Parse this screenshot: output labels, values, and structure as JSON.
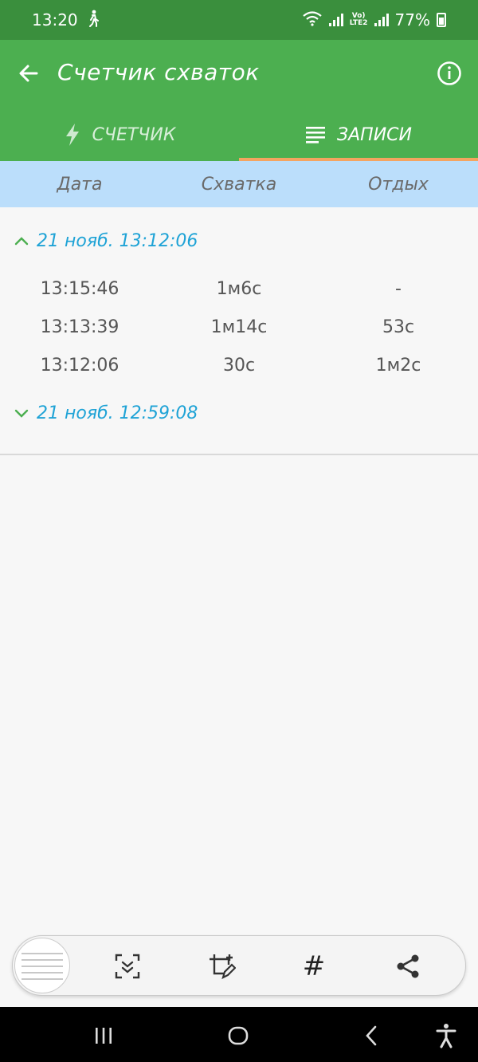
{
  "status_bar": {
    "time": "13:20",
    "battery_text": "77%",
    "lte_line1": "Vo)",
    "lte_line2": "LTE2",
    "icons": [
      "walking-icon",
      "wifi-icon",
      "signal-icon",
      "signal-icon",
      "battery-icon"
    ]
  },
  "app_bar": {
    "title": "Счетчик схваток",
    "back_icon": "arrow-left-icon",
    "info_icon": "info-icon"
  },
  "tabs": [
    {
      "label": "СЧЕТЧИК",
      "icon": "lightning-icon",
      "active": false
    },
    {
      "label": "ЗАПИСИ",
      "icon": "list-icon",
      "active": true
    }
  ],
  "columns": [
    "Дата",
    "Схватка",
    "Отдых"
  ],
  "groups": [
    {
      "title": "21 нояб. 13:12:06",
      "expanded": true,
      "rows": [
        {
          "time": "13:15:46",
          "contraction": "1м6с",
          "rest": "-"
        },
        {
          "time": "13:13:39",
          "contraction": "1м14с",
          "rest": "53с"
        },
        {
          "time": "13:12:06",
          "contraction": "30с",
          "rest": "1м2с"
        }
      ]
    },
    {
      "title": "21 нояб. 12:59:08",
      "expanded": false,
      "rows": []
    }
  ],
  "screenshot_toolbar": {
    "buttons": [
      "scroll-capture-icon",
      "crop-edit-icon",
      "hashtag-icon",
      "share-icon"
    ],
    "hashtag_text": "#"
  },
  "colors": {
    "status_bar": "#3a8f3d",
    "app_bar": "#4caf50",
    "tab_indicator": "#f4a460",
    "header_bg": "#bbdefb",
    "group_text": "#1fa3d6",
    "chevron": "#4caf50"
  }
}
